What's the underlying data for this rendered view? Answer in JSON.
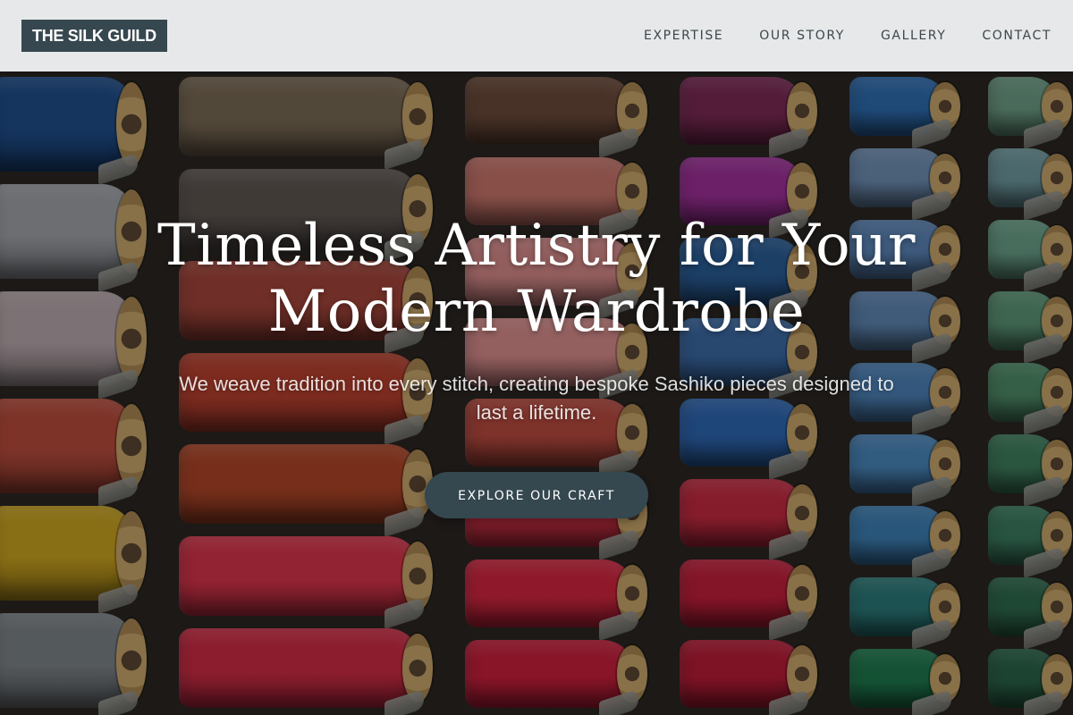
{
  "header": {
    "logo_text": "THE SILK GUILD",
    "nav": [
      {
        "label": "EXPERTISE"
      },
      {
        "label": "OUR STORY"
      },
      {
        "label": "GALLERY"
      },
      {
        "label": "CONTACT"
      }
    ]
  },
  "hero": {
    "title_line1": "Timeless Artistry for Your",
    "title_line2": "Modern Wardrobe",
    "subtitle": "We weave tradition into every stitch, creating bespoke Sashiko pieces designed to last a lifetime.",
    "cta_label": "EXPLORE OUR CRAFT"
  },
  "colors": {
    "header_bg": "#eef0f2",
    "logo_bg": "#36474f",
    "cta_bg": "#35474f",
    "nav_text": "#3c464c"
  }
}
